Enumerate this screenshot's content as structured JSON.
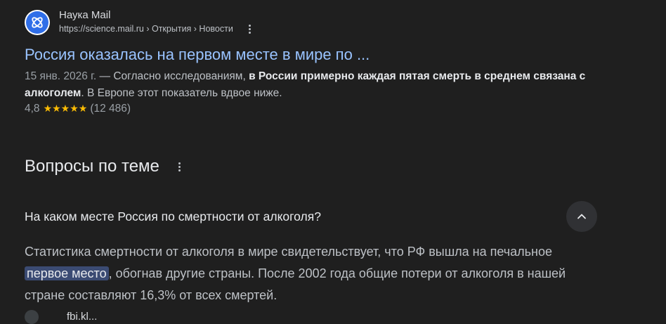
{
  "result": {
    "site_name": "Наука Mail",
    "site_url": "https://science.mail.ru › Открытия › Новости",
    "logo_icon": "science-atom-icon",
    "logo_color": "#2f6ee8",
    "title": "Россия оказалась на первом месте в мире по ...",
    "snippet": {
      "date": "15 янв. 2026 г.",
      "separator": " — ",
      "text_1": "Согласно исследованиям, ",
      "bold": "в России примерно каждая пятая смерть в среднем связана с алкоголем",
      "text_2": ". В Европе этот показатель вдвое ниже."
    },
    "rating": {
      "value": "4,8",
      "stars": "★★★★★",
      "count": "(12 486)"
    }
  },
  "paa": {
    "title": "Вопросы по теме",
    "question": "На каком месте Россия по смертности от алкоголя?",
    "answer": {
      "text_1": "Статистика смертности от алкоголя в мире свидетельствует, что РФ вышла на печальное ",
      "highlight": "первое место",
      "text_2": ", обогнав другие страны. После 2002 года общие потери от алкоголя в нашей стране составляют 16,3% от всех смертей."
    }
  },
  "colors": {
    "background": "#1f1f1f",
    "link": "#99c3ff",
    "star": "#fbbc04",
    "highlight": "#3b4b73"
  },
  "next_source": {
    "text": "fbi.kl..."
  }
}
